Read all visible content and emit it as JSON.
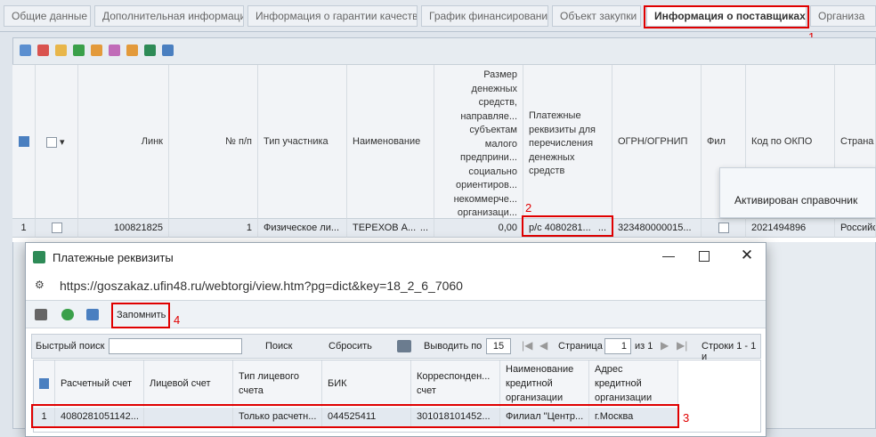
{
  "tabs": [
    "Общие данные",
    "Дополнительная информация",
    "Информация о гарантии качества",
    "График финансирования",
    "Объект закупки",
    "Информация о поставщиках",
    "Организа"
  ],
  "annotations": [
    "1",
    "2",
    "3",
    "4"
  ],
  "grid": {
    "headers": {
      "link": "Линк",
      "num": "№ п/п",
      "type": "Тип участника",
      "name": "Наименование",
      "amount": "Размер денежных средств, направляе... субъектам малого предприни... социально ориентиров... некоммерче... организаци...",
      "payment": "Платежные реквизиты для перечисления денежных средств",
      "ogrn": "ОГРН/ОГРНИП",
      "fil": "Фил",
      "okpo": "Код по ОКПО",
      "country": "Страна"
    },
    "row": {
      "rownum": "1",
      "link": "100821825",
      "num": "1",
      "type": "Физическое ли...",
      "name": "ТЕРЕХОВ А...",
      "name_more": "...",
      "amount": "0,00",
      "payment": "р/с 4080281...",
      "payment_more": "...",
      "ogrn": "323480000015...",
      "okpo": "2021494896",
      "country": "Российс"
    }
  },
  "popup": {
    "text": "Активирован справочник"
  },
  "dialog": {
    "title": "Платежные реквизиты",
    "url": "https://goszakaz.ufin48.ru/webtorgi/view.htm?pg=dict&key=18_2_6_7060",
    "remember": "Запомнить",
    "search": {
      "label": "Быстрый поиск",
      "value": "",
      "find": "Поиск",
      "reset": "Сбросить",
      "show_label": "Выводить по",
      "show_value": "15",
      "page_label": "Страница",
      "page_value": "1",
      "of": "из 1",
      "rows": "Строки 1 - 1 и"
    },
    "headers": [
      "Расчетный счет",
      "Лицевой счет",
      "Тип лицевого счета",
      "БИК",
      "Корреспонден... счет",
      "Наименование кредитной организации",
      "Адрес кредитной организации"
    ],
    "row": {
      "rownum": "1",
      "account": "4080281051142...",
      "personal": "",
      "acc_type": "Только расчетн...",
      "bik": "044525411",
      "corr": "301018101452...",
      "bank": "Филиал \"Центр...",
      "address": "г.Москва"
    }
  },
  "colors": {
    "accent_red": "#e00000",
    "header_bg": "#f2f4f7",
    "row_bg": "#e5eaf0"
  }
}
